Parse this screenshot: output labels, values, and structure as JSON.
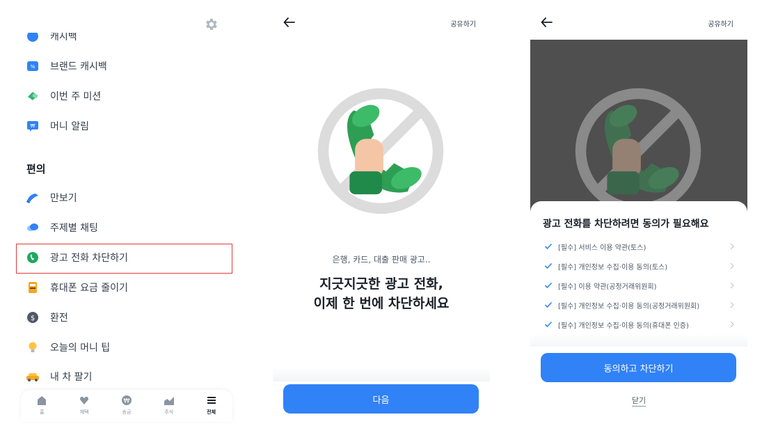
{
  "screen1": {
    "menu_top": [
      {
        "label": "캐시백",
        "icon": "cashback-icon"
      },
      {
        "label": "브랜드 캐시백",
        "icon": "brand-cashback-icon"
      },
      {
        "label": "이번 주 미션",
        "icon": "mission-icon"
      },
      {
        "label": "머니 알림",
        "icon": "money-alert-icon"
      }
    ],
    "section_title": "편의",
    "menu_convenience": [
      {
        "label": "만보기",
        "icon": "pedometer-icon"
      },
      {
        "label": "주제별 채팅",
        "icon": "chat-icon"
      },
      {
        "label": "광고 전화 차단하기",
        "icon": "shield-icon"
      },
      {
        "label": "휴대폰 요금 줄이기",
        "icon": "phone-bill-icon"
      },
      {
        "label": "환전",
        "icon": "dollar-icon"
      },
      {
        "label": "오늘의 머니 팁",
        "icon": "lightbulb-icon"
      },
      {
        "label": "내 차 팔기",
        "icon": "car-icon"
      }
    ],
    "tabs": [
      {
        "label": "홈",
        "icon": "home-icon"
      },
      {
        "label": "혜택",
        "icon": "benefit-icon"
      },
      {
        "label": "송금",
        "icon": "transfer-icon"
      },
      {
        "label": "주식",
        "icon": "stock-icon"
      },
      {
        "label": "전체",
        "icon": "menu-icon",
        "active": true
      }
    ],
    "highlight_color": "#e03b3b"
  },
  "screen2": {
    "share_label": "공유하기",
    "sub_copy": "은행, 카드, 대출 판매 광고..",
    "headline_line1": "지긋지긋한 광고 전화,",
    "headline_line2": "이제 한 번에 차단하세요",
    "next_button": "다음"
  },
  "screen3": {
    "share_label": "공유하기",
    "sheet_title": "광고 전화를 차단하려면 동의가 필요해요",
    "agreements": [
      "[필수] 서비스 이용 약관(토스)",
      "[필수] 개인정보 수집·이용 동의(토스)",
      "[필수] 이용 약관(공정거래위원회)",
      "[필수] 개인정보 수집·이용 동의(공정거래위원회)",
      "[필수] 개인정보 수집·이용 동의(휴대폰 인증)"
    ],
    "agree_button": "동의하고 차단하기",
    "close_label": "닫기"
  },
  "colors": {
    "primary": "#3182f6",
    "text_dark": "#191f28",
    "text_sub": "#4e5968"
  }
}
